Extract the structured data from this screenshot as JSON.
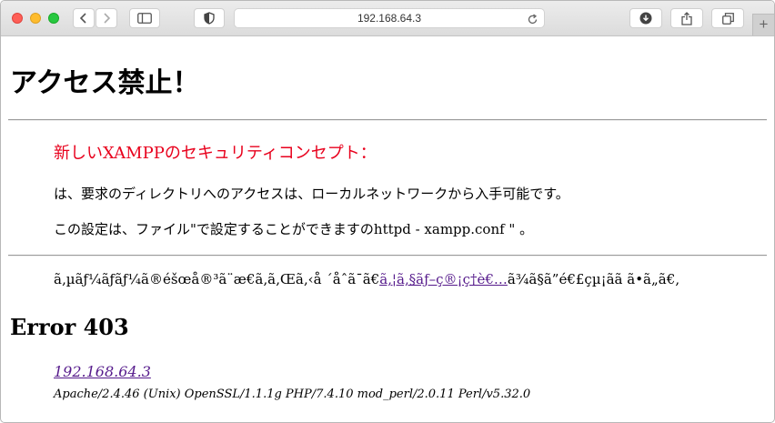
{
  "browser": {
    "address": "192.168.64.3",
    "icons": [
      "back-icon",
      "forward-icon",
      "sidebar-icon",
      "shield-icon",
      "reload-icon",
      "download-icon",
      "share-icon",
      "tabs-icon",
      "plus-icon"
    ],
    "new_tab_label": "+"
  },
  "page": {
    "title": "アクセス禁止！",
    "subtitle": "新しいXAMPPのセキュリティコンセプト：",
    "line1": "は、要求のディレクトリへのアクセスは、ローカルネットワークから入手可能です。",
    "line2": "この設定は、ファイル\"で設定することができますのhttpd - xampp.conf \" 。",
    "garbled_before": "ã‚µãƒ¼ãƒãƒ¼ã®éšœå®³ã¨æ€ã‚ã‚Œã‚‹å ´åˆã¯ã€",
    "garbled_link": "ã‚¦ã‚§ãƒ–ç®¡ç†è€…",
    "garbled_after": "ã¾ã§ã”é€£çµ¡ãã ã•ã„ã€‚",
    "error_heading": "Error 403",
    "host_link": "192.168.64.3",
    "server_info": "Apache/2.4.46 (Unix) OpenSSL/1.1.1g PHP/7.4.10 mod_perl/2.0.11 Perl/v5.32.0"
  }
}
